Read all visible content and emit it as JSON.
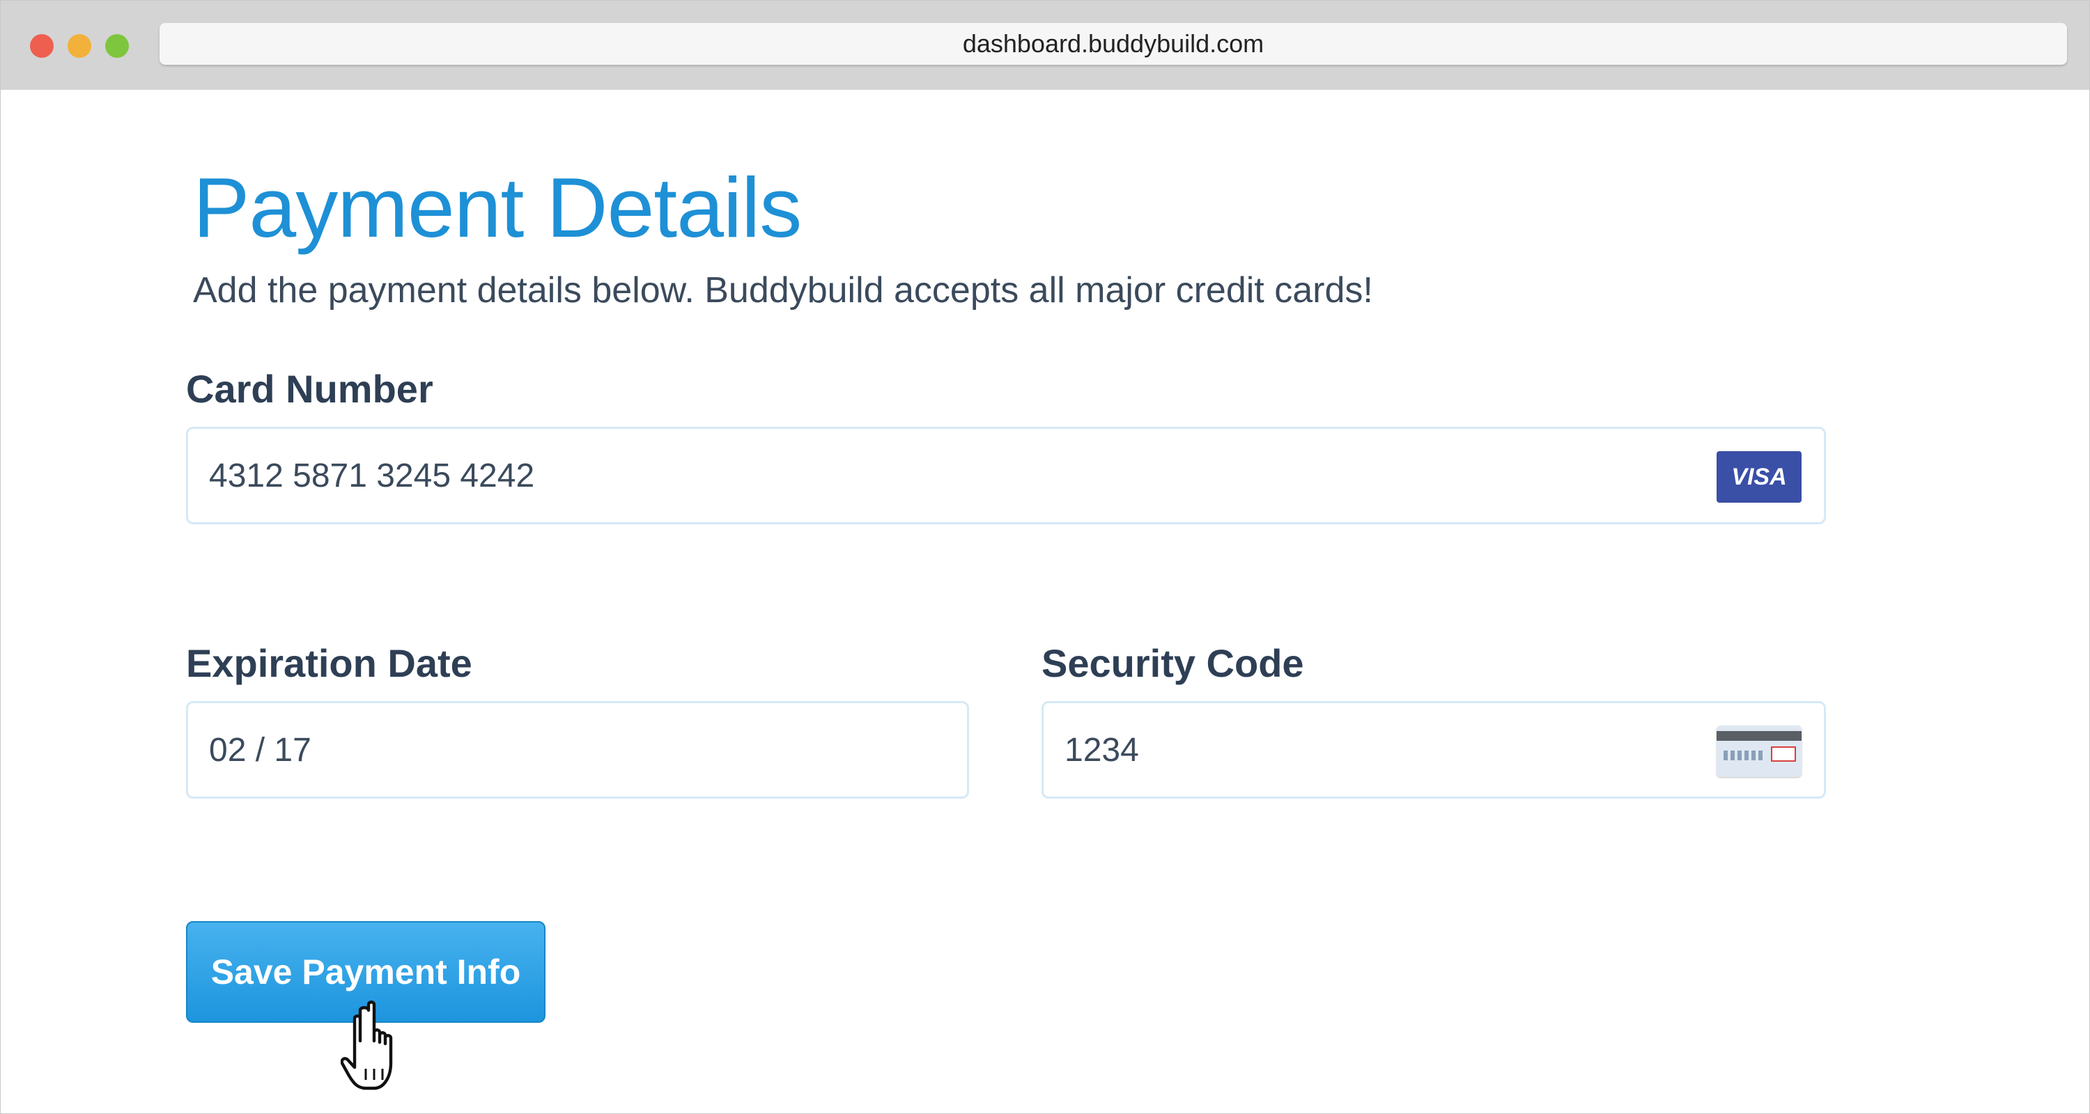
{
  "browser": {
    "url": "dashboard.buddybuild.com"
  },
  "page": {
    "title": "Payment Details",
    "subtitle": "Add the payment details below. Buddybuild accepts all major credit cards!"
  },
  "form": {
    "card_number": {
      "label": "Card Number",
      "value": "4312 5871 3245 4242",
      "brand": "VISA"
    },
    "expiration": {
      "label": "Expiration Date",
      "value": "02 / 17"
    },
    "security_code": {
      "label": "Security Code",
      "value": "1234"
    },
    "submit_label": "Save Payment Info"
  },
  "colors": {
    "accent": "#1e90d6",
    "button": "#1d95de",
    "label_text": "#2e3f55",
    "visa_blue": "#3a4fa6"
  },
  "icons": {
    "card_brand": "visa-icon",
    "cvc_hint": "credit-card-back-icon",
    "cursor": "pointer-hand-icon"
  }
}
